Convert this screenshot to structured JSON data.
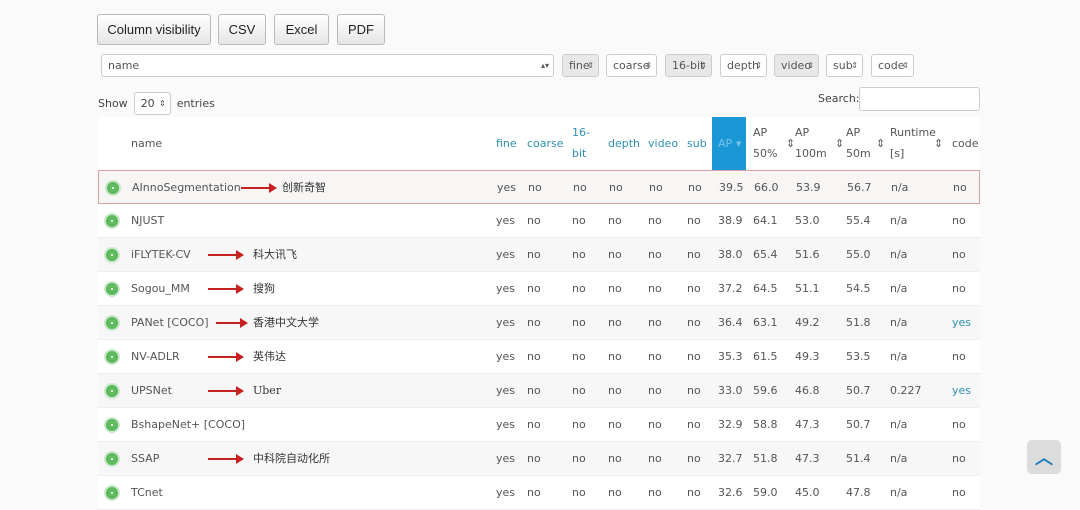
{
  "buttons": [
    "Column visibility",
    "CSV",
    "Excel",
    "PDF"
  ],
  "filters": [
    {
      "label": "name"
    },
    {
      "label": "fine"
    },
    {
      "label": "coarse"
    },
    {
      "label": "16-bit"
    },
    {
      "label": "depth"
    },
    {
      "label": "video"
    },
    {
      "label": "sub"
    },
    {
      "label": "code"
    }
  ],
  "show": {
    "prefix": "Show",
    "value": "20",
    "suffix": "entries"
  },
  "search": {
    "label": "Search:",
    "value": ""
  },
  "headers": {
    "name": "name",
    "fine": "fine",
    "coarse": "coarse",
    "bit1": "16-",
    "bit2": "bit",
    "depth": "depth",
    "video": "video",
    "sub": "sub",
    "ap": "AP",
    "ap50_1": "AP",
    "ap50_2": "50%",
    "ap100_1": "AP",
    "ap100_2": "100m",
    "ap50m_1": "AP",
    "ap50m_2": "50m",
    "rt1": "Runtime",
    "rt2": "[s]",
    "code": "code",
    "sort_icon": "⇕"
  },
  "rows": [
    {
      "name": "AInnoSegmentation",
      "org": "创新奇智",
      "fine": "yes",
      "coarse": "no",
      "bit": "no",
      "depth": "no",
      "video": "no",
      "sub": "no",
      "ap": "39.5",
      "ap50": "66.0",
      "ap100": "53.9",
      "ap50m": "56.7",
      "runtime": "n/a",
      "code": "no"
    },
    {
      "name": "NJUST",
      "org": "",
      "fine": "yes",
      "coarse": "no",
      "bit": "no",
      "depth": "no",
      "video": "no",
      "sub": "no",
      "ap": "38.9",
      "ap50": "64.1",
      "ap100": "53.0",
      "ap50m": "55.4",
      "runtime": "n/a",
      "code": "no"
    },
    {
      "name": "iFLYTEK-CV",
      "org": "科大讯飞",
      "fine": "yes",
      "coarse": "no",
      "bit": "no",
      "depth": "no",
      "video": "no",
      "sub": "no",
      "ap": "38.0",
      "ap50": "65.4",
      "ap100": "51.6",
      "ap50m": "55.0",
      "runtime": "n/a",
      "code": "no"
    },
    {
      "name": "Sogou_MM",
      "org": "搜狗",
      "fine": "yes",
      "coarse": "no",
      "bit": "no",
      "depth": "no",
      "video": "no",
      "sub": "no",
      "ap": "37.2",
      "ap50": "64.5",
      "ap100": "51.1",
      "ap50m": "54.5",
      "runtime": "n/a",
      "code": "no"
    },
    {
      "name": "PANet [COCO]",
      "org": "香港中文大学",
      "fine": "yes",
      "coarse": "no",
      "bit": "no",
      "depth": "no",
      "video": "no",
      "sub": "no",
      "ap": "36.4",
      "ap50": "63.1",
      "ap100": "49.2",
      "ap50m": "51.8",
      "runtime": "n/a",
      "code": "yes"
    },
    {
      "name": "NV-ADLR",
      "org": "英伟达",
      "fine": "yes",
      "coarse": "no",
      "bit": "no",
      "depth": "no",
      "video": "no",
      "sub": "no",
      "ap": "35.3",
      "ap50": "61.5",
      "ap100": "49.3",
      "ap50m": "53.5",
      "runtime": "n/a",
      "code": "no"
    },
    {
      "name": "UPSNet",
      "org": "Uber",
      "fine": "yes",
      "coarse": "no",
      "bit": "no",
      "depth": "no",
      "video": "no",
      "sub": "no",
      "ap": "33.0",
      "ap50": "59.6",
      "ap100": "46.8",
      "ap50m": "50.7",
      "runtime": "0.227",
      "code": "yes"
    },
    {
      "name": "BshapeNet+ [COCO]",
      "org": "",
      "fine": "yes",
      "coarse": "no",
      "bit": "no",
      "depth": "no",
      "video": "no",
      "sub": "no",
      "ap": "32.9",
      "ap50": "58.8",
      "ap100": "47.3",
      "ap50m": "50.7",
      "runtime": "n/a",
      "code": "no"
    },
    {
      "name": "SSAP",
      "org": "中科院自动化所",
      "fine": "yes",
      "coarse": "no",
      "bit": "no",
      "depth": "no",
      "video": "no",
      "sub": "no",
      "ap": "32.7",
      "ap50": "51.8",
      "ap100": "47.3",
      "ap50m": "51.4",
      "runtime": "n/a",
      "code": "no"
    },
    {
      "name": "TCnet",
      "org": "",
      "fine": "yes",
      "coarse": "no",
      "bit": "no",
      "depth": "no",
      "video": "no",
      "sub": "no",
      "ap": "32.6",
      "ap50": "59.0",
      "ap100": "45.0",
      "ap50m": "47.8",
      "runtime": "n/a",
      "code": "no"
    }
  ],
  "scroll_top_icon": "chevron-up-icon"
}
